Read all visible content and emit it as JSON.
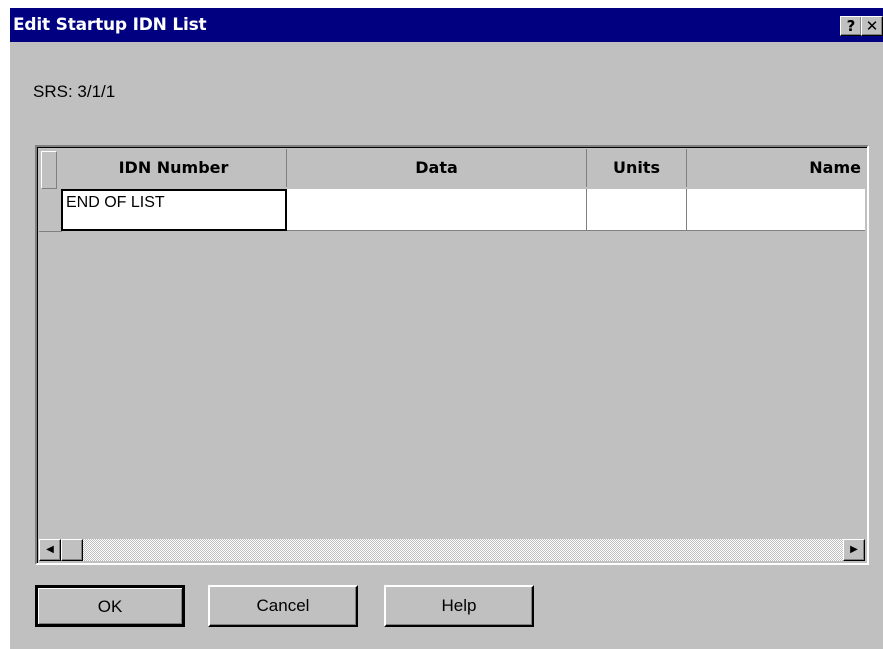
{
  "window": {
    "title": "Edit Startup IDN List",
    "help_glyph": "?",
    "close_glyph": "✕"
  },
  "srs_label": "SRS: 3/1/1",
  "table": {
    "columns": [
      "IDN Number",
      "Data",
      "Units",
      "Name"
    ],
    "rows": [
      [
        "END OF LIST",
        "",
        "",
        ""
      ]
    ]
  },
  "scrollbar": {
    "left_arrow_icon": "◀",
    "right_arrow_icon": "▶"
  },
  "buttons": {
    "ok": "OK",
    "cancel": "Cancel",
    "help": "Help"
  },
  "colors": {
    "title_bar": "#000080",
    "dialog_face": "#c0c0c0"
  }
}
